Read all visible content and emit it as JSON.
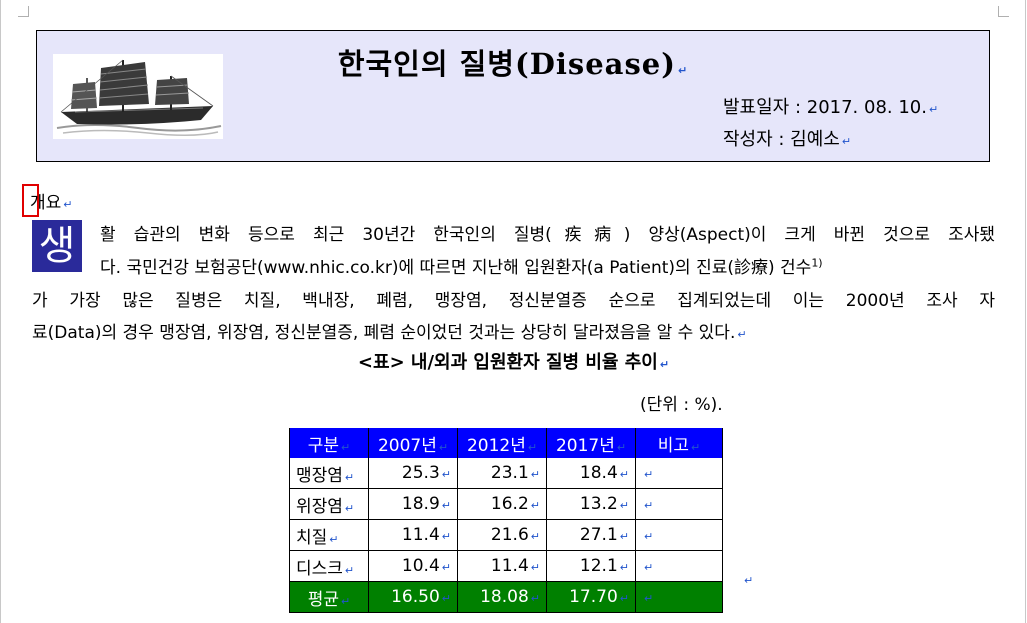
{
  "header": {
    "title": "한국인의 질병(Disease)",
    "date_line": "발표일자 : 2017. 08. 10.",
    "author_line": "작성자 : 김예소"
  },
  "section": {
    "heading": "개요"
  },
  "body": {
    "dropcap": "생",
    "line1": "활 습관의 변화 등으로 최근 30년간 한국인의 질병(疾病) 양상(Aspect)이 크게 바뀐 것으로 조사됐",
    "line2_a": "다. 국민건강 보험공단(www.nhic.co.kr)에 따르면 지난해 입원환자(a Patient)의 진료(診療) 건수",
    "footnote_ref": "1)",
    "line3": "가 가장 많은 질병은 치질, 백내장, 폐렴, 맹장염, 정신분열증 순으로 집계되었는데 이는 2000년 조사 자",
    "line4": "료(Data)의 경우 맹장염, 위장염, 정신분열증, 폐렴 순이었던 것과는 상당히 달라졌음을 알 수 있다."
  },
  "table_caption": "<표> 내/외과 입원환자 질병 비율 추이",
  "unit_note": "(단위 : %).",
  "table": {
    "headers": [
      "구분",
      "2007년",
      "2012년",
      "2017년",
      "비고"
    ],
    "rows": [
      {
        "name": "맹장염",
        "v2007": "25.3",
        "v2012": "23.1",
        "v2017": "18.4"
      },
      {
        "name": "위장염",
        "v2007": "18.9",
        "v2012": "16.2",
        "v2017": "13.2"
      },
      {
        "name": "치질",
        "v2007": "11.4",
        "v2012": "21.6",
        "v2017": "27.1"
      },
      {
        "name": "디스크",
        "v2007": "10.4",
        "v2012": "11.4",
        "v2017": "12.1"
      }
    ],
    "average": {
      "name": "평균",
      "v2007": "16.50",
      "v2012": "18.08",
      "v2017": "17.70"
    }
  },
  "colors": {
    "header_bg": "#e6e6fa",
    "dropcap_bg": "#2a2a9a",
    "table_header_bg": "#0000ff",
    "table_avg_bg": "#008000",
    "cursor_box": "#e00000"
  },
  "icons": {
    "logo": "sailing-junk-ship-image",
    "paragraph_mark": "return-arrow"
  }
}
